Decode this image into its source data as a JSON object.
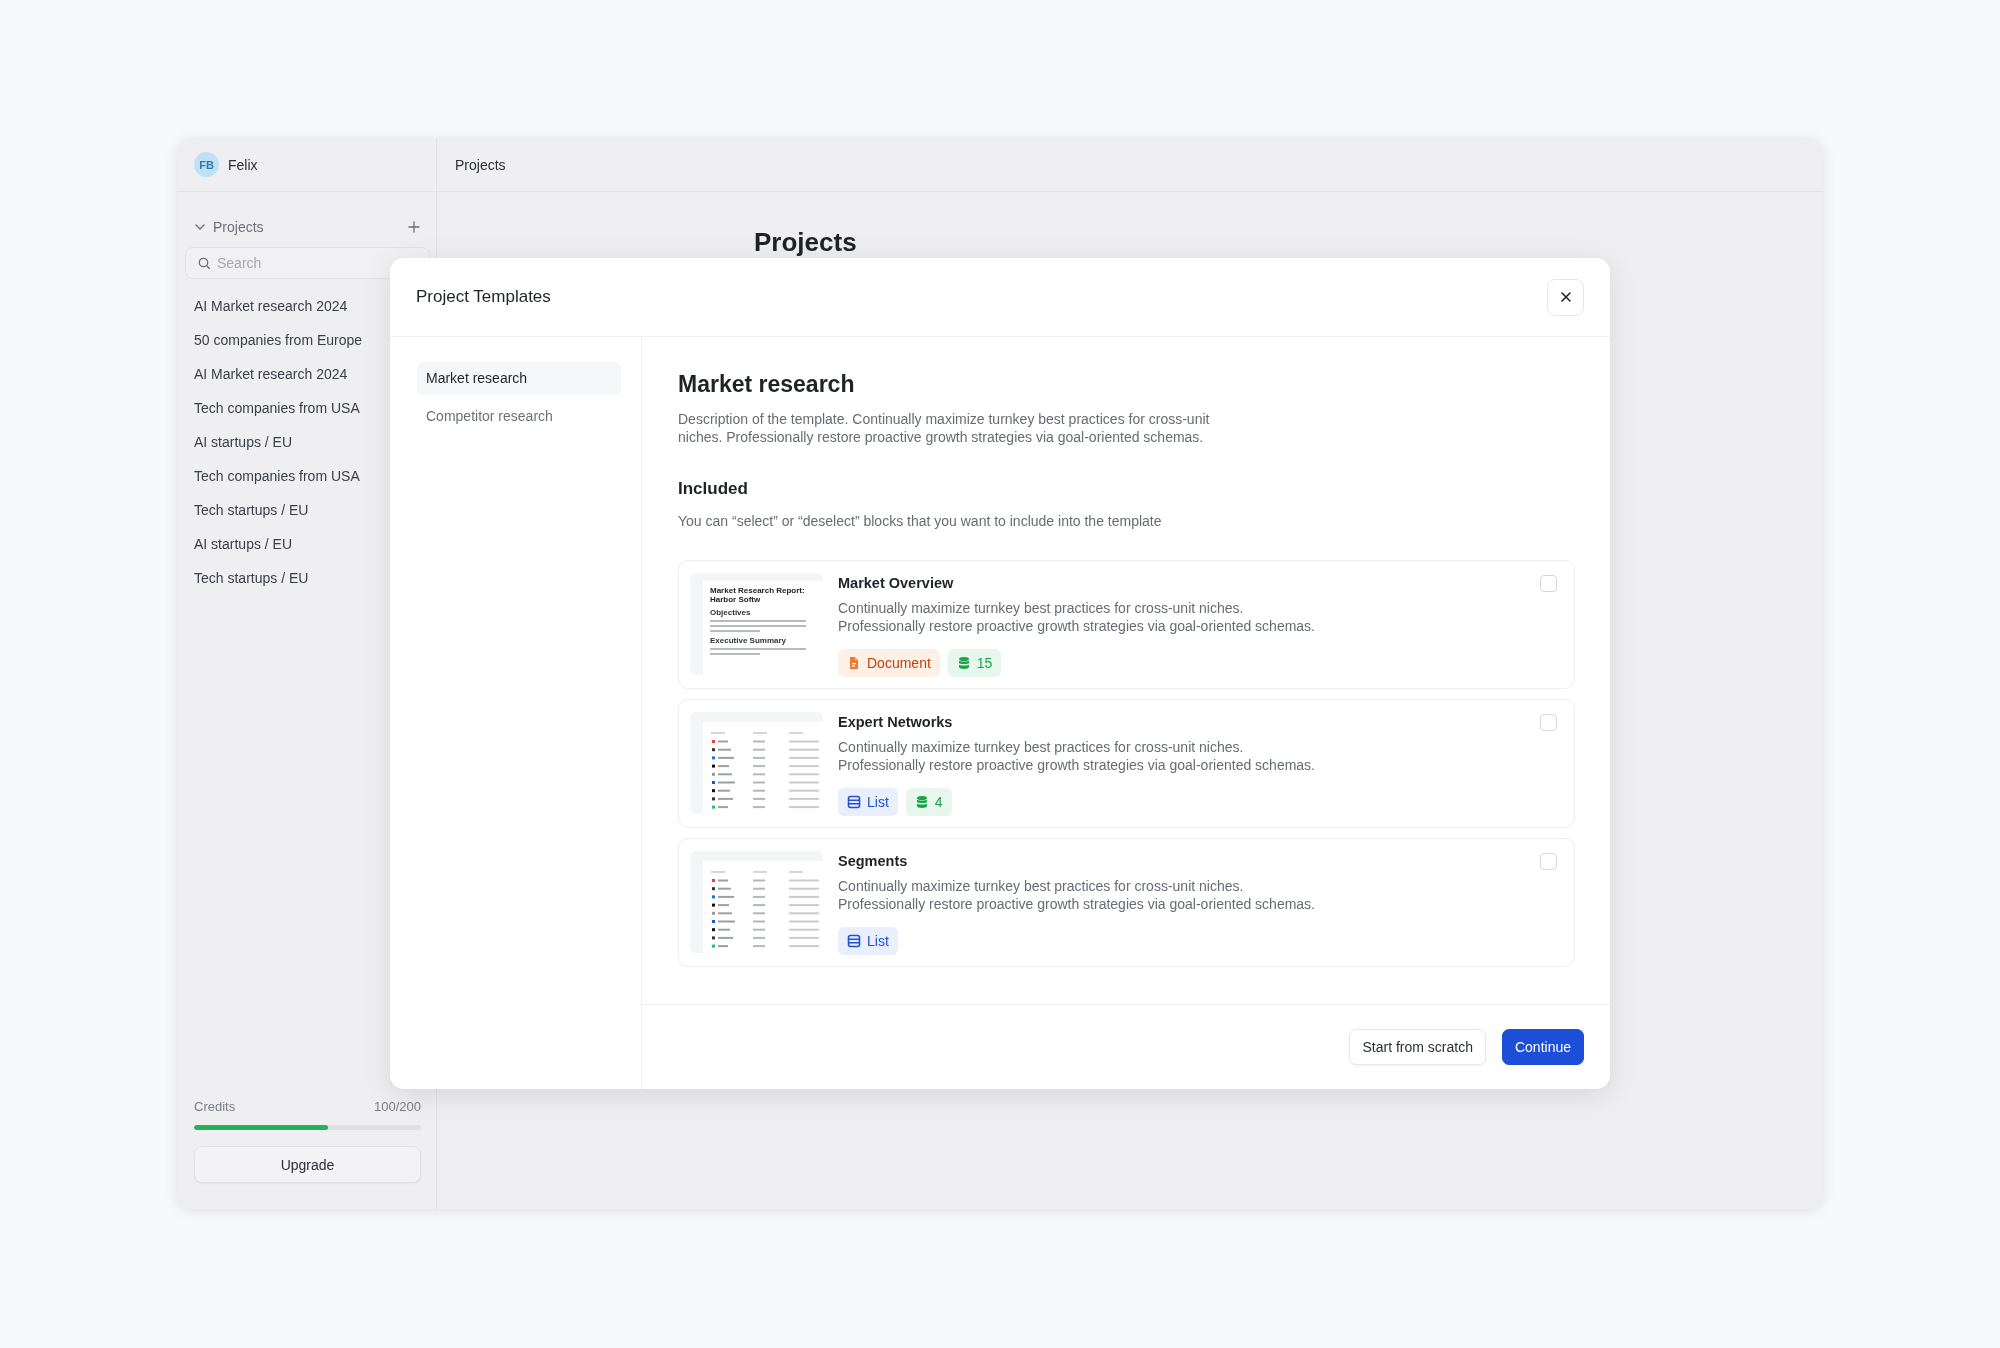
{
  "user": {
    "initials": "FB",
    "name": "Felix"
  },
  "header": {
    "title": "Projects"
  },
  "sidebar": {
    "section": {
      "label": "Projects",
      "expanded": true
    },
    "search": {
      "placeholder": "Search"
    },
    "items": [
      "AI Market research 2024",
      "50 companies from Europe",
      "AI Market research 2024",
      "Tech companies from USA",
      "AI startups / EU",
      "Tech companies from USA",
      "Tech startups / EU",
      "AI startups / EU",
      "Tech startups / EU"
    ],
    "credits": {
      "label": "Credits",
      "reading": "100/200",
      "level": 0.59
    },
    "upgrade_button": "Upgrade"
  },
  "main": {
    "heading": "Projects"
  },
  "modal": {
    "title": "Project Templates",
    "nav": [
      {
        "label": "Market research",
        "selected": true
      },
      {
        "label": "Competitor research",
        "selected": false
      }
    ],
    "template": {
      "title": "Market research",
      "description": "Description of the template. Continually maximize turnkey best practices for cross-unit niches. Professionally restore proactive growth strategies via goal-oriented schemas.",
      "included_heading": "Included",
      "included_hint": "You can “select” or “deselect” blocks that you want to include into the template"
    },
    "blocks": [
      {
        "title": "Market Overview",
        "description": "Continually maximize turnkey best practices for cross-unit niches. Professionally restore proactive growth strategies via goal-oriented schemas.",
        "checked": false,
        "preview": {
          "kind": "document",
          "heading": "Market Research Report: Harbor Softw",
          "sections": [
            "Objectives",
            "Executive Summary"
          ]
        },
        "tags": [
          {
            "kind": "document",
            "label": "Document"
          },
          {
            "kind": "sources",
            "label": "15"
          }
        ]
      },
      {
        "title": "Expert Networks",
        "description": "Continually maximize turnkey best practices for cross-unit niches. Professionally restore proactive growth strategies via goal-oriented schemas.",
        "checked": false,
        "preview": {
          "kind": "table"
        },
        "tags": [
          {
            "kind": "list",
            "label": "List"
          },
          {
            "kind": "sources",
            "label": "4"
          }
        ]
      },
      {
        "title": "Segments",
        "description": "Continually maximize turnkey best practices for cross-unit niches. Professionally restore proactive growth strategies via goal-oriented schemas.",
        "checked": false,
        "preview": {
          "kind": "table"
        },
        "tags": [
          {
            "kind": "list",
            "label": "List"
          }
        ]
      }
    ],
    "buttons": [
      {
        "kind": "secondary",
        "label": "Start from scratch"
      },
      {
        "kind": "primary",
        "label": "Continue"
      }
    ]
  }
}
